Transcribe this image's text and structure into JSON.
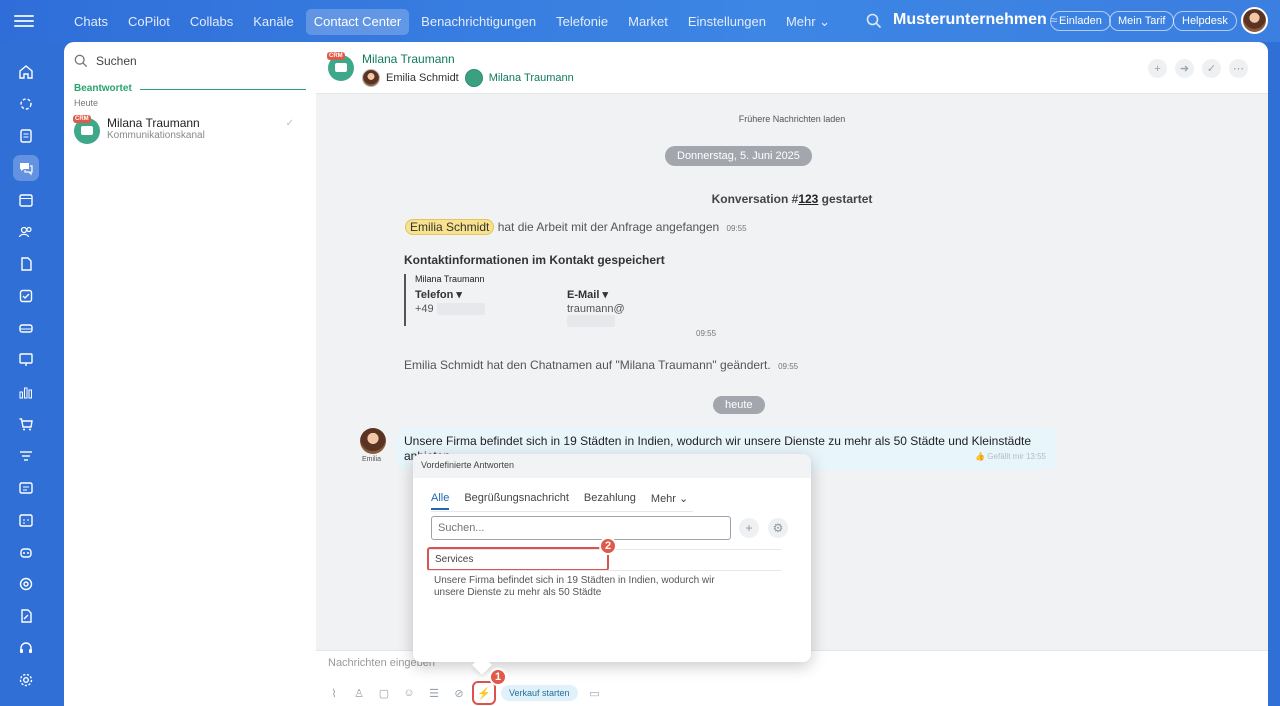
{
  "topbar": {
    "nav": [
      "Chats",
      "CoPilot",
      "Collabs",
      "Kanäle",
      "Contact Center",
      "Benachrichtigungen",
      "Telefonie",
      "Market",
      "Einstellungen",
      "Mehr ⌄"
    ],
    "active_nav": "Contact Center",
    "company": "Musterunternehmen",
    "buttons": [
      "Einladen",
      "Mein Tarif",
      "Helpdesk"
    ]
  },
  "sidebar": {
    "icons": [
      "home-icon",
      "activity-icon",
      "feed-icon",
      "chat-icon",
      "calendar-icon",
      "people-icon",
      "document-icon",
      "tasks-icon",
      "drive-icon",
      "presentation-icon",
      "analytics-icon",
      "shop-icon",
      "filter-icon",
      "id-card-icon",
      "schedule-icon",
      "robot-icon",
      "target-icon",
      "edit-doc-icon",
      "headset-icon",
      "settings-icon"
    ]
  },
  "list": {
    "search_placeholder": "Suchen",
    "section": "Beantwortet",
    "group": "Heute",
    "crm_tag": "CRM",
    "item": {
      "name": "Milana Traumann",
      "subtitle": "Kommunikationskanal"
    }
  },
  "chat": {
    "title": "Milana Traumann",
    "crm_tag": "CRM",
    "user1": "Emilia Schmidt",
    "user2": "Milana Traumann",
    "load_more": "Frühere Nachrichten laden",
    "date": "Donnerstag, 5. Juni 2025",
    "conv_prefix": "Konversation #",
    "conv_number": "123",
    "conv_suffix": " gestartet",
    "sys1_name": "Emilia Schmidt",
    "sys1_text": "hat die Arbeit mit der Anfrage angefangen",
    "sys1_time": "09:55",
    "contact_title": "Kontaktinformationen im Kontakt gespeichert",
    "contact_name": "Milana Traumann",
    "phone_label": "Telefon ▾",
    "phone_value": "+49",
    "email_label": "E-Mail ▾",
    "email_value": "traumann@",
    "contact_time": "09:55",
    "sys2_text": "Emilia Schmidt hat den Chatnamen auf \"Milana Traumann\" geändert.",
    "sys2_time": "09:55",
    "today": "heute",
    "msg_author": "Emilia",
    "msg_text": "Unsere Firma befindet sich in 19 Städten in Indien, wodurch wir unsere Dienste zu mehr als 50 Städte und Kleinstädte anbieten",
    "msg_meta": "👍 Gefällt mir   13:55",
    "composer_placeholder": "Nachrichten eingeben",
    "sale_label": "Verkauf starten"
  },
  "popup": {
    "title": "Vordefinierte Antworten",
    "tabs": [
      "Alle",
      "Begrüßungsnachricht",
      "Bezahlung",
      "Mehr ⌄"
    ],
    "search_placeholder": "Suchen...",
    "item_title": "Services",
    "item_text": "Unsere Firma befindet sich in 19 Städten in Indien, wodurch wir unsere Dienste zu mehr als 50 Städte"
  },
  "badges": [
    "1",
    "2"
  ],
  "colors": {
    "accent": "#2f6ed9",
    "green": "#2aa371",
    "highlight": "#d9534f"
  }
}
